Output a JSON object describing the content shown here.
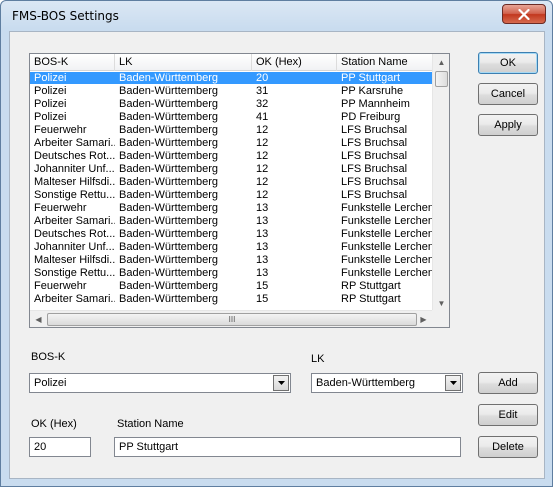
{
  "window": {
    "title": "FMS-BOS Settings",
    "close_icon": "close-icon"
  },
  "list": {
    "columns": [
      "BOS-K",
      "LK",
      "OK (Hex)",
      "Station Name"
    ],
    "rows": [
      [
        "Polizei",
        "Baden-Württemberg",
        "20",
        "PP Stuttgart"
      ],
      [
        "Polizei",
        "Baden-Württemberg",
        "31",
        "PP Karsruhe"
      ],
      [
        "Polizei",
        "Baden-Württemberg",
        "32",
        "PP Mannheim"
      ],
      [
        "Polizei",
        "Baden-Württemberg",
        "41",
        "PD Freiburg"
      ],
      [
        "Feuerwehr",
        "Baden-Württemberg",
        "12",
        "LFS Bruchsal"
      ],
      [
        "Arbeiter Samari...",
        "Baden-Württemberg",
        "12",
        "LFS Bruchsal"
      ],
      [
        "Deutsches Rot...",
        "Baden-Württemberg",
        "12",
        "LFS Bruchsal"
      ],
      [
        "Johanniter Unf...",
        "Baden-Württemberg",
        "12",
        "LFS Bruchsal"
      ],
      [
        "Malteser Hilfsdi...",
        "Baden-Württemberg",
        "12",
        "LFS Bruchsal"
      ],
      [
        "Sonstige Rettu...",
        "Baden-Württemberg",
        "12",
        "LFS Bruchsal"
      ],
      [
        "Feuerwehr",
        "Baden-Württemberg",
        "13",
        "Funkstelle Lerchenbe"
      ],
      [
        "Arbeiter Samari...",
        "Baden-Württemberg",
        "13",
        "Funkstelle Lerchenbe"
      ],
      [
        "Deutsches Rot...",
        "Baden-Württemberg",
        "13",
        "Funkstelle Lerchenbe"
      ],
      [
        "Johanniter Unf...",
        "Baden-Württemberg",
        "13",
        "Funkstelle Lerchenbe"
      ],
      [
        "Malteser Hilfsdi...",
        "Baden-Württemberg",
        "13",
        "Funkstelle Lerchenbe"
      ],
      [
        "Sonstige Rettu...",
        "Baden-Württemberg",
        "13",
        "Funkstelle Lerchenbe"
      ],
      [
        "Feuerwehr",
        "Baden-Württemberg",
        "15",
        "RP Stuttgart"
      ],
      [
        "Arbeiter Samari...",
        "Baden-Württemberg",
        "15",
        "RP Stuttgart"
      ]
    ],
    "selected_row": 0,
    "hscroll_grip": "III"
  },
  "buttons": {
    "ok": "OK",
    "cancel": "Cancel",
    "apply": "Apply",
    "add": "Add",
    "edit": "Edit",
    "delete": "Delete"
  },
  "form": {
    "bosk_label": "BOS-K",
    "bosk_value": "Polizei",
    "lk_label": "LK",
    "lk_value": "Baden-Württemberg",
    "okhex_label": "OK (Hex)",
    "okhex_value": "20",
    "station_label": "Station Name",
    "station_value": "PP Stuttgart"
  },
  "colors": {
    "selection": "#3399ff",
    "close_button": "#c2371e"
  }
}
